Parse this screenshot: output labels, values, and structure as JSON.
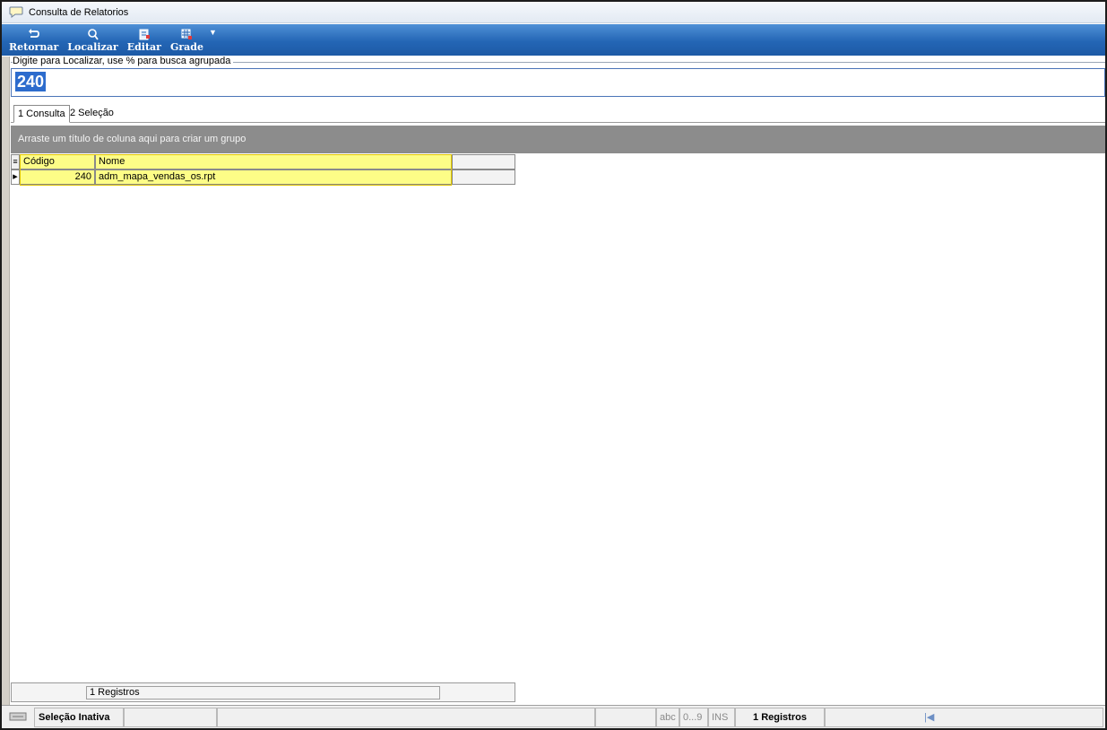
{
  "window": {
    "title": "Consulta de Relatorios",
    "icon": "chat-bubble-icon"
  },
  "toolbar": {
    "buttons": [
      {
        "label": "Retornar",
        "icon": "return-arrow-icon"
      },
      {
        "label": "Localizar",
        "icon": "magnifier-icon"
      },
      {
        "label": "Editar",
        "icon": "edit-icon"
      },
      {
        "label": "Grade",
        "icon": "grid-icon"
      }
    ],
    "dropdown_icon": "triangle-down-icon",
    "colors": {
      "top": "#4f90d6",
      "bottom": "#1d5aa6"
    }
  },
  "search": {
    "legend": "Digite para Localizar, use % para busca agrupada",
    "value": "240"
  },
  "tabs": [
    {
      "label": "1 Consulta",
      "active": true
    },
    {
      "label": "2 Seleção",
      "active": false
    }
  ],
  "group_band": {
    "text": "Arraste um título de coluna aqui para criar um grupo"
  },
  "grid": {
    "columns": [
      "Código",
      "Nome"
    ],
    "rows": [
      {
        "codigo": "240",
        "nome": "adm_mapa_vendas_os.rpt"
      }
    ],
    "highlight_color": "#fdfd87"
  },
  "footer": {
    "count": "1 Registros"
  },
  "statusbar": {
    "keyboard_icon": "keyboard-icon",
    "selection": "Seleção Inativa",
    "abc": "abc",
    "digits": "0...9",
    "ins": "INS",
    "records": "1 Registros",
    "nav_icon": "first-record-icon"
  }
}
